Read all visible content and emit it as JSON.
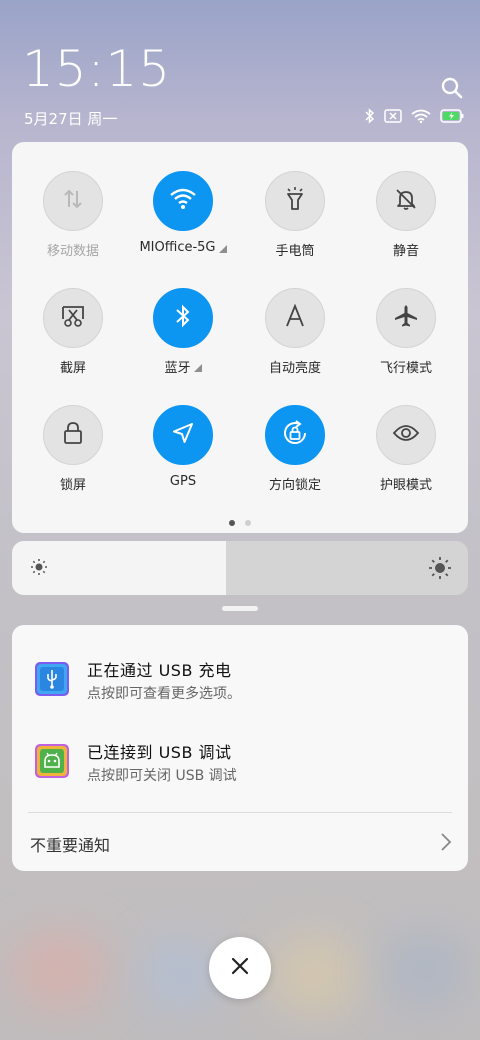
{
  "status_bar": {
    "time": "15:15",
    "date": "5月27日 周一",
    "icons": [
      "bluetooth-icon",
      "sim-disabled-icon",
      "wifi-icon",
      "battery-charging-icon"
    ]
  },
  "quick_settings": {
    "tiles": [
      {
        "label": "移动数据",
        "icon": "mobile-data-icon",
        "active": false,
        "disabled": true
      },
      {
        "label": "MIOffice-5G",
        "icon": "wifi-icon",
        "active": true,
        "has_menu": true
      },
      {
        "label": "手电筒",
        "icon": "flashlight-icon",
        "active": false
      },
      {
        "label": "静音",
        "icon": "mute-bell-icon",
        "active": false
      },
      {
        "label": "截屏",
        "icon": "screenshot-icon",
        "active": false
      },
      {
        "label": "蓝牙",
        "icon": "bluetooth-icon",
        "active": true,
        "has_menu": true
      },
      {
        "label": "自动亮度",
        "icon": "auto-brightness-icon",
        "active": false
      },
      {
        "label": "飞行模式",
        "icon": "airplane-icon",
        "active": false
      },
      {
        "label": "锁屏",
        "icon": "lock-icon",
        "active": false
      },
      {
        "label": "GPS",
        "icon": "location-arrow-icon",
        "active": true
      },
      {
        "label": "方向锁定",
        "icon": "rotation-lock-icon",
        "active": true
      },
      {
        "label": "护眼模式",
        "icon": "eye-icon",
        "active": false
      }
    ],
    "page_count": 2,
    "current_page": 1
  },
  "brightness": {
    "level_percent": 47
  },
  "notifications": [
    {
      "title": "正在通过 USB 充电",
      "subtitle": "点按即可查看更多选项。",
      "icon": "usb-icon"
    },
    {
      "title": "已连接到 USB 调试",
      "subtitle": "点按即可关闭 USB 调试",
      "icon": "android-debug-icon"
    }
  ],
  "notification_footer": {
    "label": "不重要通知"
  },
  "colors": {
    "accent": "#0d95f2",
    "panel": "#f6f6f7"
  }
}
